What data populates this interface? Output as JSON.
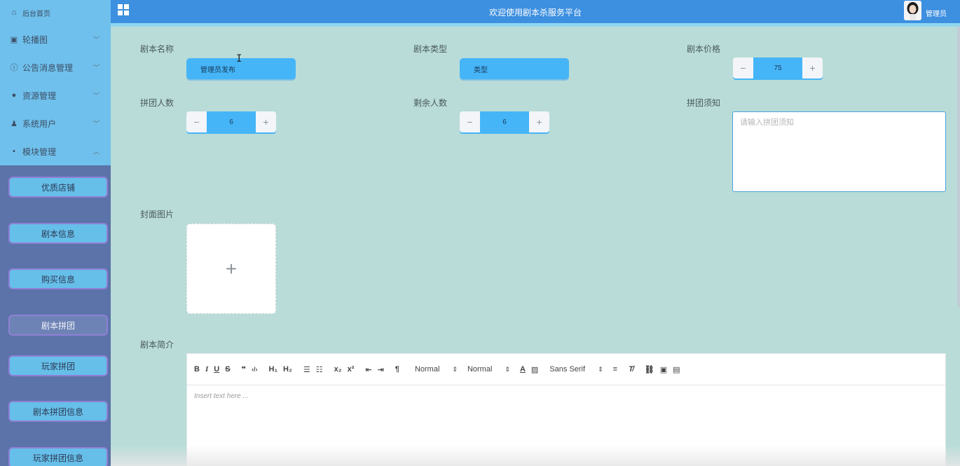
{
  "header": {
    "title": "欢迎使用剧本杀服务平台",
    "user_name": "管理员"
  },
  "sidebar": {
    "home": "后台首页",
    "items": [
      {
        "label": "轮播图",
        "icon": "image-icon"
      },
      {
        "label": "公告消息管理",
        "icon": "info-circle-icon"
      },
      {
        "label": "资源管理",
        "icon": "location-pin-icon"
      },
      {
        "label": "系统用户",
        "icon": "user-icon"
      },
      {
        "label": "模块管理",
        "icon": "grid-icon"
      }
    ],
    "sub_items": [
      {
        "label": "优质店铺",
        "active": false
      },
      {
        "label": "剧本信息",
        "active": false
      },
      {
        "label": "购买信息",
        "active": false
      },
      {
        "label": "剧本拼团",
        "active": true
      },
      {
        "label": "玩家拼团",
        "active": false
      },
      {
        "label": "剧本拼团信息",
        "active": false
      },
      {
        "label": "玩家拼团信息",
        "active": false
      }
    ]
  },
  "form": {
    "script_name": {
      "label": "剧本名称",
      "value": "管理员发布"
    },
    "script_type": {
      "label": "剧本类型",
      "value": "类型"
    },
    "script_price": {
      "label": "剧本价格",
      "value": "75"
    },
    "group_size": {
      "label": "拼团人数",
      "value": "6"
    },
    "remaining": {
      "label": "剩余人数",
      "value": "6"
    },
    "group_notice": {
      "label": "拼团须知",
      "placeholder": "请输入拼团须知"
    },
    "cover": {
      "label": "封面图片"
    },
    "intro": {
      "label": "剧本简介",
      "placeholder": "Insert text here ..."
    }
  },
  "editor_toolbar": {
    "header_select": "Normal",
    "size_select": "Normal",
    "font_select": "Sans Serif"
  },
  "colors": {
    "header": "#3d8fe0",
    "sidebar_top": "#6fc0ec",
    "sidebar_bottom": "#5b73a8",
    "content_bg": "#b9dcd8",
    "input_fill": "#46b5f7"
  }
}
